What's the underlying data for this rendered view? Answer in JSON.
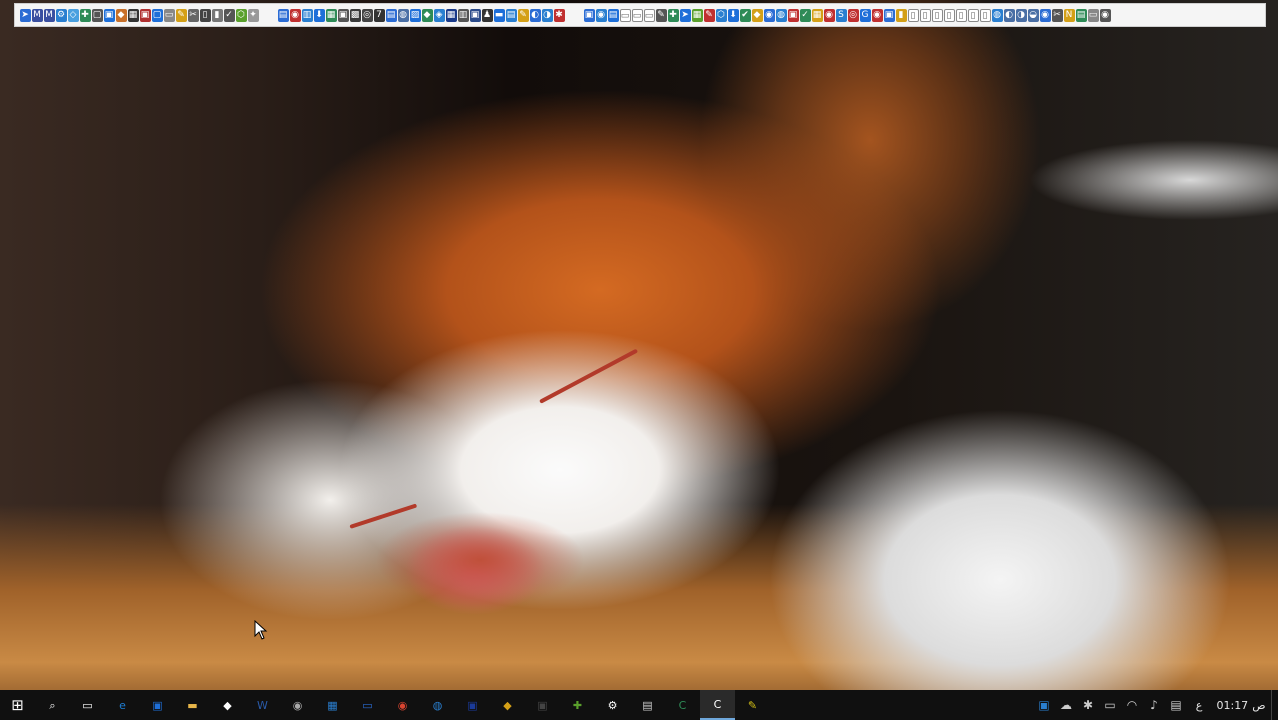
{
  "desktop": {
    "wallpaper": "sleeping-kitten-photo"
  },
  "top_toolbar": {
    "left_icons": [
      {
        "name": "app-icon-1",
        "color": "#2b6cd4",
        "glyph": "➤"
      },
      {
        "name": "app-icon-2",
        "color": "#3a4fa0",
        "glyph": "M"
      },
      {
        "name": "app-icon-3",
        "color": "#3a4fa0",
        "glyph": "M"
      },
      {
        "name": "app-icon-4",
        "color": "#2a7fd0",
        "glyph": "⚙"
      },
      {
        "name": "app-icon-5",
        "color": "#4aa0e0",
        "glyph": "◇"
      },
      {
        "name": "app-icon-6",
        "color": "#2e8b57",
        "glyph": "✚"
      },
      {
        "name": "app-icon-7",
        "color": "#555555",
        "glyph": "▢"
      },
      {
        "name": "app-icon-8",
        "color": "#1e6fd9",
        "glyph": "▣"
      },
      {
        "name": "app-icon-9",
        "color": "#c8702a",
        "glyph": "◆"
      },
      {
        "name": "app-icon-10",
        "color": "#333333",
        "glyph": "▦"
      },
      {
        "name": "app-icon-11",
        "color": "#b03030",
        "glyph": "▣"
      },
      {
        "name": "app-icon-12",
        "color": "#1e6fd9",
        "glyph": "▢"
      },
      {
        "name": "app-icon-13",
        "color": "#888888",
        "glyph": "▭"
      },
      {
        "name": "app-icon-14",
        "color": "#d4a017",
        "glyph": "✎"
      },
      {
        "name": "app-icon-15",
        "color": "#666666",
        "glyph": "✂"
      },
      {
        "name": "app-icon-16",
        "color": "#444444",
        "glyph": "▯"
      },
      {
        "name": "app-icon-17",
        "color": "#777777",
        "glyph": "▮"
      },
      {
        "name": "app-icon-18",
        "color": "#555555",
        "glyph": "✓"
      },
      {
        "name": "app-icon-19",
        "color": "#5aa02c",
        "glyph": "⬡"
      },
      {
        "name": "app-icon-20",
        "color": "#999999",
        "glyph": "✦"
      }
    ],
    "middle_icons": [
      {
        "name": "app-icon-21",
        "color": "#2b6cd4",
        "glyph": "▤"
      },
      {
        "name": "app-icon-22",
        "color": "#c03030",
        "glyph": "◉"
      },
      {
        "name": "app-icon-23",
        "color": "#2a7fd0",
        "glyph": "▥"
      },
      {
        "name": "app-icon-24",
        "color": "#1e6fd9",
        "glyph": "⬇"
      },
      {
        "name": "app-icon-25",
        "color": "#2e8b57",
        "glyph": "▦"
      },
      {
        "name": "app-icon-26",
        "color": "#555555",
        "glyph": "▣"
      },
      {
        "name": "app-icon-27",
        "color": "#3a3a3a",
        "glyph": "▩"
      },
      {
        "name": "app-icon-28",
        "color": "#444444",
        "glyph": "◎"
      },
      {
        "name": "app-icon-29",
        "color": "#333333",
        "glyph": "7"
      },
      {
        "name": "app-icon-30",
        "color": "#2b6cd4",
        "glyph": "▤"
      },
      {
        "name": "app-icon-31",
        "color": "#4a6fa5",
        "glyph": "◍"
      },
      {
        "name": "app-icon-32",
        "color": "#1e6fd9",
        "glyph": "▨"
      },
      {
        "name": "app-icon-33",
        "color": "#2e8b57",
        "glyph": "◆"
      },
      {
        "name": "app-icon-34",
        "color": "#2a7fd0",
        "glyph": "◈"
      },
      {
        "name": "app-icon-35",
        "color": "#1a3a8a",
        "glyph": "▦"
      },
      {
        "name": "app-icon-36",
        "color": "#555555",
        "glyph": "▥"
      },
      {
        "name": "app-icon-37",
        "color": "#2a4a8a",
        "glyph": "▣"
      },
      {
        "name": "app-icon-38",
        "color": "#333333",
        "glyph": "♟"
      },
      {
        "name": "app-icon-39",
        "color": "#1e6fd9",
        "glyph": "▬"
      },
      {
        "name": "app-icon-40",
        "color": "#2a7fd0",
        "glyph": "▤"
      },
      {
        "name": "app-icon-41",
        "color": "#d4a017",
        "glyph": "✎"
      },
      {
        "name": "app-icon-42",
        "color": "#2b6cd4",
        "glyph": "◐"
      },
      {
        "name": "app-icon-43",
        "color": "#2a7fd0",
        "glyph": "◑"
      },
      {
        "name": "app-icon-44",
        "color": "#c03030",
        "glyph": "✱"
      }
    ],
    "right_icons": [
      {
        "name": "app-icon-45",
        "color": "#2b6cd4",
        "glyph": "▣"
      },
      {
        "name": "app-icon-46",
        "color": "#2a7fd0",
        "glyph": "◉"
      },
      {
        "name": "app-icon-47",
        "color": "#1e6fd9",
        "glyph": "▤"
      },
      {
        "name": "app-icon-48",
        "color": "#ffffff",
        "glyph": "▭"
      },
      {
        "name": "app-icon-49",
        "color": "#ffffff",
        "glyph": "▭"
      },
      {
        "name": "app-icon-50",
        "color": "#ffffff",
        "glyph": "▭"
      },
      {
        "name": "app-icon-51",
        "color": "#555555",
        "glyph": "✎"
      },
      {
        "name": "app-icon-52",
        "color": "#2e8b57",
        "glyph": "✚"
      },
      {
        "name": "app-icon-53",
        "color": "#1e6fd9",
        "glyph": "➤"
      },
      {
        "name": "app-icon-54",
        "color": "#5aa02c",
        "glyph": "▦"
      },
      {
        "name": "app-icon-55",
        "color": "#c03030",
        "glyph": "✎"
      },
      {
        "name": "app-icon-56",
        "color": "#2a7fd0",
        "glyph": "⬡"
      },
      {
        "name": "app-icon-57",
        "color": "#1e6fd9",
        "glyph": "⬇"
      },
      {
        "name": "app-icon-58",
        "color": "#2e8b57",
        "glyph": "✔"
      },
      {
        "name": "app-icon-59",
        "color": "#d4a017",
        "glyph": "◆"
      },
      {
        "name": "app-icon-60",
        "color": "#2b6cd4",
        "glyph": "◉"
      },
      {
        "name": "app-icon-61",
        "color": "#2a7fd0",
        "glyph": "◍"
      },
      {
        "name": "app-icon-62",
        "color": "#c03030",
        "glyph": "▣"
      },
      {
        "name": "app-icon-63",
        "color": "#2e8b57",
        "glyph": "✓"
      },
      {
        "name": "app-icon-64",
        "color": "#d4a017",
        "glyph": "▦"
      },
      {
        "name": "app-icon-65",
        "color": "#c03030",
        "glyph": "◉"
      },
      {
        "name": "app-icon-66",
        "color": "#2a7fd0",
        "glyph": "S"
      },
      {
        "name": "app-icon-67",
        "color": "#c03030",
        "glyph": "◎"
      },
      {
        "name": "app-icon-68",
        "color": "#1e6fd9",
        "glyph": "G"
      },
      {
        "name": "app-icon-69",
        "color": "#c03030",
        "glyph": "◉"
      },
      {
        "name": "app-icon-70",
        "color": "#2b6cd4",
        "glyph": "▣"
      },
      {
        "name": "app-icon-71",
        "color": "#d4a017",
        "glyph": "▮"
      },
      {
        "name": "app-icon-72",
        "color": "#ffffff",
        "glyph": "▯"
      },
      {
        "name": "app-icon-73",
        "color": "#ffffff",
        "glyph": "▯"
      },
      {
        "name": "app-icon-74",
        "color": "#ffffff",
        "glyph": "▯"
      },
      {
        "name": "app-icon-75",
        "color": "#ffffff",
        "glyph": "▯"
      },
      {
        "name": "app-icon-76",
        "color": "#ffffff",
        "glyph": "▯"
      },
      {
        "name": "app-icon-77",
        "color": "#ffffff",
        "glyph": "▯"
      },
      {
        "name": "app-icon-78",
        "color": "#ffffff",
        "glyph": "▯"
      },
      {
        "name": "app-icon-79",
        "color": "#2a7fd0",
        "glyph": "◍"
      },
      {
        "name": "app-icon-80",
        "color": "#4a6fa5",
        "glyph": "◐"
      },
      {
        "name": "app-icon-81",
        "color": "#4a6fa5",
        "glyph": "◑"
      },
      {
        "name": "app-icon-82",
        "color": "#4a6fa5",
        "glyph": "◒"
      },
      {
        "name": "app-icon-83",
        "color": "#2b6cd4",
        "glyph": "◉"
      },
      {
        "name": "app-icon-84",
        "color": "#555555",
        "glyph": "✂"
      },
      {
        "name": "app-icon-85",
        "color": "#d4a017",
        "glyph": "N"
      },
      {
        "name": "app-icon-86",
        "color": "#2e8b57",
        "glyph": "▤"
      },
      {
        "name": "app-icon-87",
        "color": "#888888",
        "glyph": "▭"
      },
      {
        "name": "app-icon-88",
        "color": "#555555",
        "glyph": "◉"
      }
    ]
  },
  "taskbar": {
    "start": {
      "name": "windows-start-icon",
      "glyph": "⊞",
      "color": "#ffffff"
    },
    "apps": [
      {
        "name": "search-icon",
        "glyph": "⌕",
        "color": "#ffffff"
      },
      {
        "name": "task-view-icon",
        "glyph": "▭",
        "color": "#ffffff"
      },
      {
        "name": "edge-browser-icon",
        "glyph": "e",
        "color": "#1e7fd6"
      },
      {
        "name": "media-app-icon",
        "glyph": "▣",
        "color": "#1e6fd9"
      },
      {
        "name": "file-explorer-icon",
        "glyph": "▬",
        "color": "#e8b64a"
      },
      {
        "name": "store-icon",
        "glyph": "◆",
        "color": "#ffffff"
      },
      {
        "name": "word-app-icon",
        "glyph": "W",
        "color": "#2a5aa8"
      },
      {
        "name": "user-app-icon",
        "glyph": "◉",
        "color": "#aaaaaa"
      },
      {
        "name": "calculator-app-icon",
        "glyph": "▦",
        "color": "#2a7fd0"
      },
      {
        "name": "monitor-app-icon",
        "glyph": "▭",
        "color": "#2b6cd4"
      },
      {
        "name": "chrome-icon",
        "glyph": "◉",
        "color": "#d94430"
      },
      {
        "name": "sync-app-icon",
        "glyph": "◍",
        "color": "#2a7fd0"
      },
      {
        "name": "blue-app-icon",
        "glyph": "▣",
        "color": "#1a3a9a"
      },
      {
        "name": "package-app-icon",
        "glyph": "◆",
        "color": "#d4a017"
      },
      {
        "name": "dark-app-icon",
        "glyph": "▣",
        "color": "#444444"
      },
      {
        "name": "tools-app-icon",
        "glyph": "✚",
        "color": "#5aa02c"
      },
      {
        "name": "settings-gear-icon",
        "glyph": "⚙",
        "color": "#ffffff"
      },
      {
        "name": "windows-app-icon",
        "glyph": "▤",
        "color": "#cccccc"
      },
      {
        "name": "green-app-icon",
        "glyph": "C",
        "color": "#2e8b57"
      },
      {
        "name": "c-app-icon",
        "glyph": "C",
        "color": "#ffffff"
      },
      {
        "name": "notes-app-icon",
        "glyph": "✎",
        "color": "#d4c017"
      }
    ],
    "active_app": "c-app-icon",
    "tray": {
      "icons": [
        {
          "name": "tray-app-icon",
          "glyph": "▣",
          "color": "#2a7fd0"
        },
        {
          "name": "onedrive-cloud-icon",
          "glyph": "☁",
          "color": "#cccccc"
        },
        {
          "name": "bluetooth-icon",
          "glyph": "✱",
          "color": "#cccccc"
        },
        {
          "name": "battery-icon",
          "glyph": "▭",
          "color": "#cccccc"
        },
        {
          "name": "wifi-icon",
          "glyph": "◠",
          "color": "#cccccc"
        },
        {
          "name": "volume-icon",
          "glyph": "♪",
          "color": "#cccccc"
        },
        {
          "name": "action-center-icon",
          "glyph": "▤",
          "color": "#cccccc"
        }
      ],
      "language": "ع",
      "time": "01:17",
      "period": "ص"
    }
  }
}
